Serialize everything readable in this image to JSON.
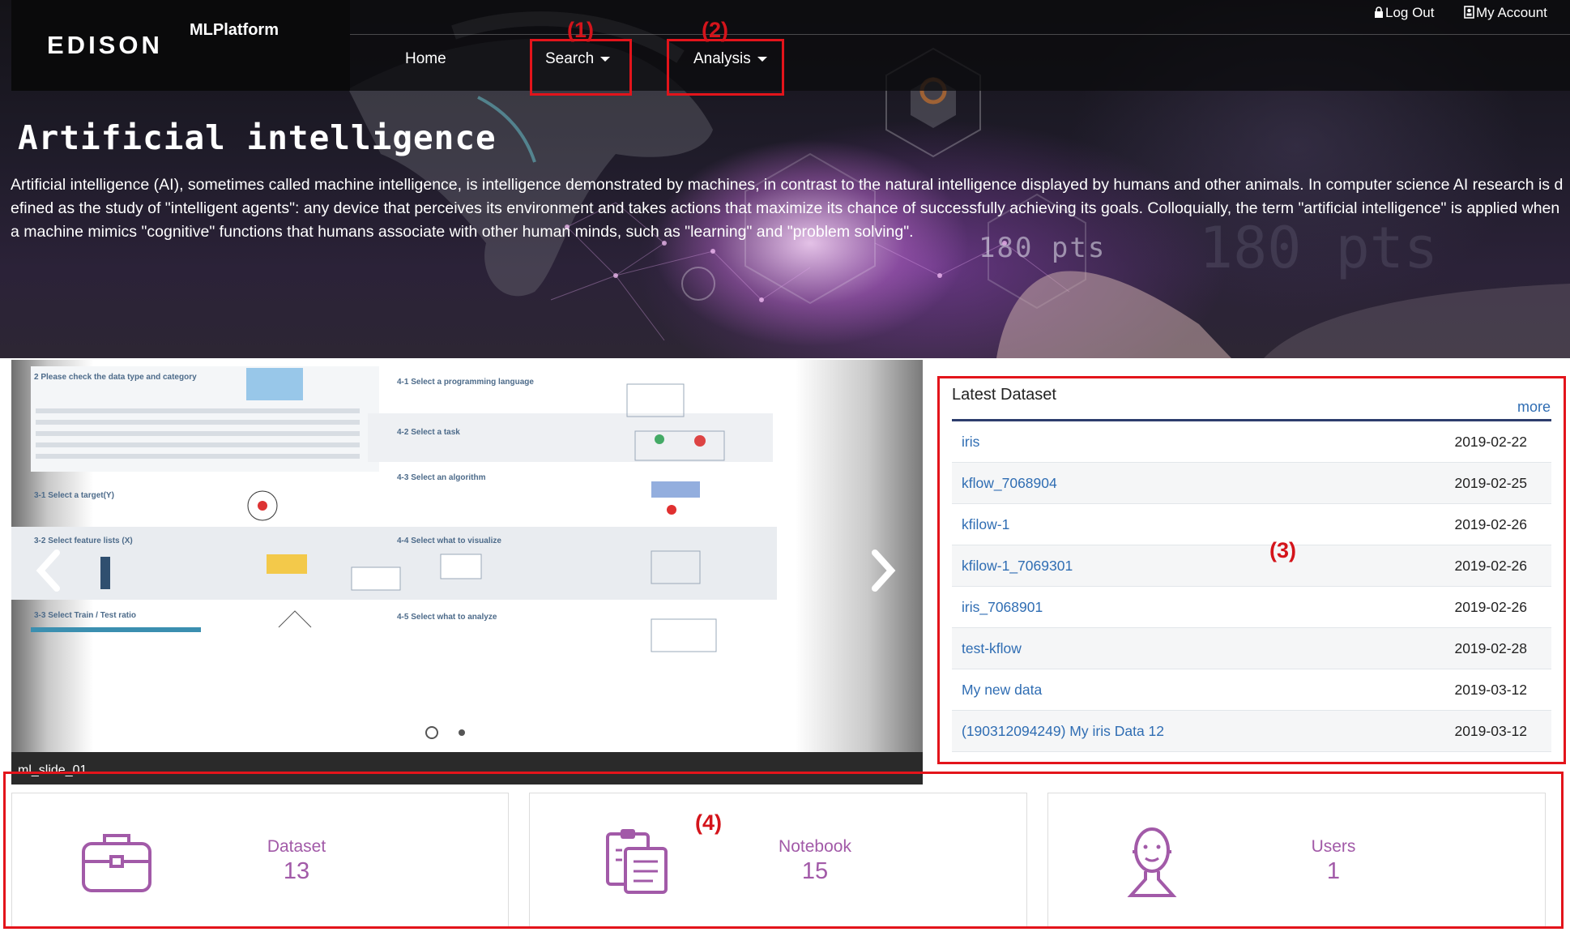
{
  "brand": {
    "logo": "EDISON",
    "platform": "MLPlatform"
  },
  "nav": {
    "items": [
      {
        "label": "Home"
      },
      {
        "label": "Search"
      },
      {
        "label": "Analysis"
      }
    ]
  },
  "account": {
    "logout": "Log Out",
    "my_account": "My Account"
  },
  "hero": {
    "title": "Artificial intelligence",
    "description": "Artificial intelligence (AI), sometimes called machine intelligence, is intelligence demonstrated by machines, in contrast to the natural intelligence displayed by humans and other animals. In computer science AI research is defined as the study of \"intelligent agents\": any device that perceives its environment and takes actions that maximize its chance of successfully achieving its goals. Colloquially, the term \"artificial intelligence\" is applied when a machine mimics \"cognitive\" functions that humans associate with other human minds, such as \"learning\" and \"problem solving\".",
    "overlay_text": "180 pts"
  },
  "annotations": {
    "a1": "(1)",
    "a2": "(2)",
    "a3": "(3)",
    "a4": "(4)"
  },
  "slider": {
    "caption": "ml_slide_01",
    "headings": [
      "2 Please check the data type and category",
      "4-1 Select a programming language",
      "4-2 Select a task",
      "4-3 Select an algorithm",
      "3-1 Select a target(Y)",
      "3-2 Select feature lists (X)",
      "4-4 Select what to visualize",
      "3-3 Select Train / Test ratio",
      "4-5 Select what to analyze"
    ],
    "dots": 2,
    "active_dot": 0
  },
  "latest_dataset": {
    "title": "Latest Dataset",
    "more": "more",
    "rows": [
      {
        "name": "iris",
        "date": "2019-02-22"
      },
      {
        "name": "kflow_7068904",
        "date": "2019-02-25"
      },
      {
        "name": "kfilow-1",
        "date": "2019-02-26"
      },
      {
        "name": "kfilow-1_7069301",
        "date": "2019-02-26"
      },
      {
        "name": "iris_7068901",
        "date": "2019-02-26"
      },
      {
        "name": "test-kflow",
        "date": "2019-02-28"
      },
      {
        "name": "My new data",
        "date": "2019-03-12"
      },
      {
        "name": "(190312094249) My iris Data 12",
        "date": "2019-03-12"
      }
    ]
  },
  "stats": [
    {
      "label": "Dataset",
      "value": "13",
      "icon": "briefcase-icon"
    },
    {
      "label": "Notebook",
      "value": "15",
      "icon": "clipboard-icon"
    },
    {
      "label": "Users",
      "value": "1",
      "icon": "user-icon"
    }
  ],
  "colors": {
    "annotation": "#e3141b",
    "stat": "#a25aa8",
    "link": "#2f6db3",
    "header": "#0a0a0b"
  }
}
